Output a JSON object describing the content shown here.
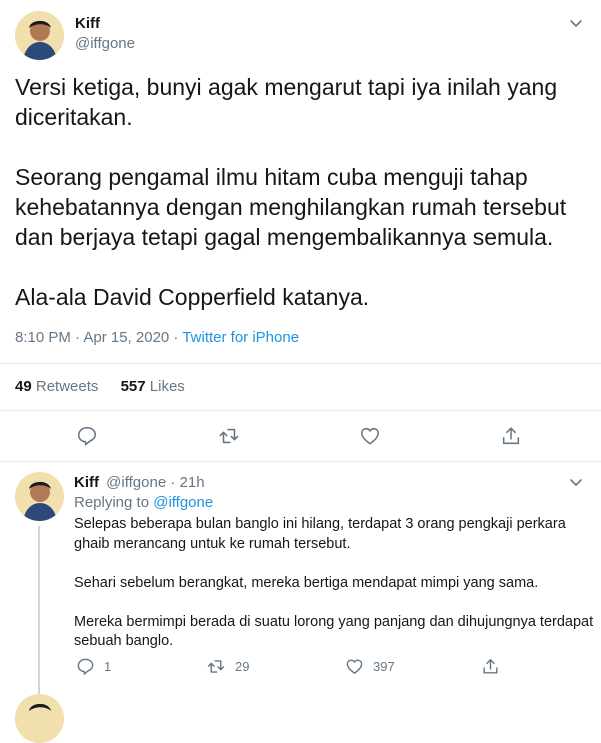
{
  "tweet": {
    "author_name": "Kiff",
    "author_handle": "@iffgone",
    "text": "Versi ketiga, bunyi agak mengarut tapi iya inilah yang diceritakan.\n\nSeorang pengamal ilmu hitam cuba menguji tahap kehebatannya dengan menghilangkan rumah tersebut dan berjaya tetapi gagal mengembalikannya semula.\n\nAla-ala David Copperfield katanya.",
    "timestamp": "8:10 PM · Apr 15, 2020 · ",
    "source": "Twitter for iPhone",
    "retweets_count": "49",
    "retweets_label": "Retweets",
    "likes_count": "557",
    "likes_label": "Likes"
  },
  "reply": {
    "author_name": "Kiff",
    "author_handle": "@iffgone",
    "age": "· 21h",
    "replying_label": "Replying to ",
    "replying_handle": "@iffgone",
    "text": "Selepas beberapa bulan banglo ini hilang, terdapat 3 orang pengkaji perkara ghaib merancang untuk ke rumah tersebut.\n\nSehari sebelum berangkat, mereka bertiga mendapat mimpi yang sama.\n\nMereka bermimpi berada di suatu lorong yang panjang dan dihujungnya terdapat sebuah banglo.",
    "reply_count": "1",
    "retweet_count": "29",
    "like_count": "397"
  },
  "colors": {
    "text": "#14171a",
    "muted": "#657786",
    "link": "#1b95e0",
    "divider": "#e6ecf0"
  },
  "icons": [
    "chevron-down-icon",
    "reply-icon",
    "retweet-icon",
    "like-icon",
    "share-icon"
  ]
}
